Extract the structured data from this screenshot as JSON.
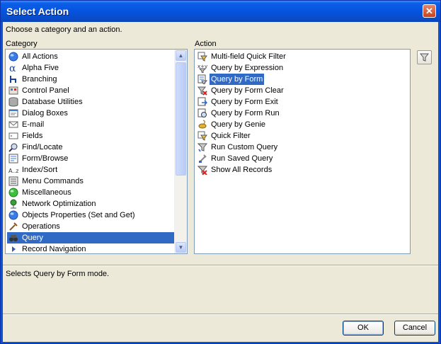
{
  "window": {
    "title": "Select Action",
    "close_glyph": "✕"
  },
  "instructions": "Choose a category and an action.",
  "category": {
    "label": "Category",
    "items": [
      {
        "label": "All Actions",
        "icon": "globe-icon"
      },
      {
        "label": "Alpha Five",
        "icon": "alpha-icon"
      },
      {
        "label": "Branching",
        "icon": "branch-icon"
      },
      {
        "label": "Control Panel",
        "icon": "control-panel-icon"
      },
      {
        "label": "Database Utilities",
        "icon": "database-icon"
      },
      {
        "label": "Dialog Boxes",
        "icon": "dialog-icon"
      },
      {
        "label": "E-mail",
        "icon": "email-icon"
      },
      {
        "label": "Fields",
        "icon": "fields-icon"
      },
      {
        "label": "Find/Locate",
        "icon": "find-icon"
      },
      {
        "label": "Form/Browse",
        "icon": "form-icon"
      },
      {
        "label": "Index/Sort",
        "icon": "sort-icon"
      },
      {
        "label": "Menu Commands",
        "icon": "menu-icon"
      },
      {
        "label": "Miscellaneous",
        "icon": "misc-icon"
      },
      {
        "label": "Network Optimization",
        "icon": "network-icon"
      },
      {
        "label": "Objects Properties (Set and Get)",
        "icon": "globe-icon"
      },
      {
        "label": "Operations",
        "icon": "operations-icon"
      },
      {
        "label": "Query",
        "icon": "binoculars-icon"
      },
      {
        "label": "Record Navigation",
        "icon": "arrow-icon"
      }
    ],
    "selected": "Query"
  },
  "action": {
    "label": "Action",
    "items": [
      {
        "label": "Multi-field Quick Filter",
        "icon": "quick-filter-icon"
      },
      {
        "label": "Query by Expression",
        "icon": "expression-icon"
      },
      {
        "label": "Query by Form",
        "icon": "query-form-icon"
      },
      {
        "label": "Query by Form Clear",
        "icon": "query-clear-icon"
      },
      {
        "label": "Query by Form Exit",
        "icon": "query-exit-icon"
      },
      {
        "label": "Query by Form Run",
        "icon": "query-run-icon"
      },
      {
        "label": "Query by Genie",
        "icon": "genie-icon"
      },
      {
        "label": "Quick Filter",
        "icon": "quick-filter-icon"
      },
      {
        "label": "Run Custom Query",
        "icon": "funnel-icon"
      },
      {
        "label": "Run Saved Query",
        "icon": "saved-query-icon"
      },
      {
        "label": "Show All Records",
        "icon": "show-all-icon"
      }
    ],
    "selected": "Query by Form"
  },
  "description": "Selects Query by Form mode.",
  "buttons": {
    "ok": "OK",
    "cancel": "Cancel"
  },
  "colors": {
    "selection": "#316ac5",
    "dialog_bg": "#ece9d8",
    "title_bar": "#0553de"
  }
}
